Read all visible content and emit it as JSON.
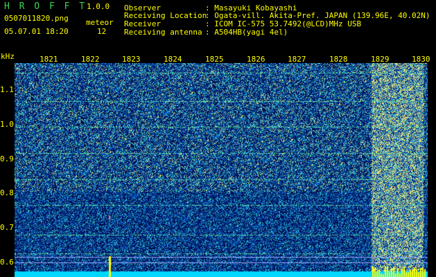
{
  "header": {
    "app_title": "H R O F F T",
    "version": "1.0.0",
    "filename": "0507011820.png",
    "datetime": "05.07.01 18:20",
    "meteor_label": "meteor",
    "meteor_count": "12"
  },
  "station_info": [
    {
      "label": "Observer",
      "value": ": Masayuki Kobayashi"
    },
    {
      "label": "Receiving Location",
      "value": ": Ogata-vill. Akita-Pref. JAPAN (139.96E, 40.02N)"
    },
    {
      "label": "Receiver",
      "value": ": ICOM IC-575 53.7492(@LCD)MHz USB"
    },
    {
      "label": "Receiving antenna",
      "value": ": A504HB(yagi 4el)"
    }
  ],
  "axis": {
    "y_unit": "kHz",
    "x_ticks": [
      "1821",
      "1822",
      "1823",
      "1824",
      "1825",
      "1826",
      "1827",
      "1828",
      "1829",
      "1830"
    ],
    "y_ticks": [
      "1.1",
      "1.0",
      "0.9",
      "0.8",
      "0.7",
      "0.6"
    ]
  },
  "colors": {
    "background": "#000000",
    "label_green": "#39d353",
    "label_yellow": "#ffff00",
    "noise_dark": "#0a1a6e",
    "noise_mid": "#1f5fc8",
    "trace": "#7fe0a0",
    "baseline": "#00d8ff"
  }
}
